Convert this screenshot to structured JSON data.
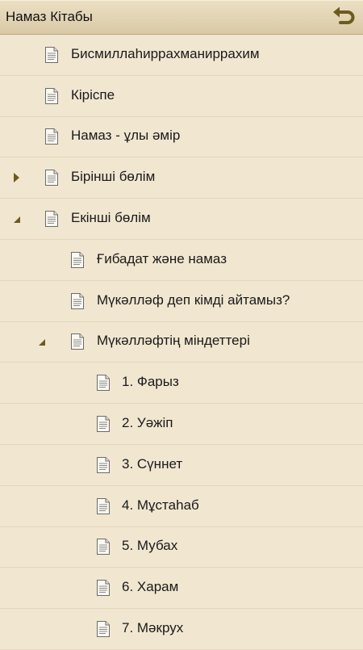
{
  "app": {
    "title": "Намаз Кітабы"
  },
  "colors": {
    "accent": "#6d5a1f",
    "background": "#f1e6d0"
  },
  "icons": {
    "back": "back-arrow-icon",
    "item": "document-icon"
  },
  "tree": [
    {
      "label": "Бисмиллаһиррахманиррахим",
      "level": 0,
      "state": "leaf"
    },
    {
      "label": "Кіріспе",
      "level": 0,
      "state": "leaf"
    },
    {
      "label": "Намаз - ұлы әмір",
      "level": 0,
      "state": "leaf"
    },
    {
      "label": "Бірінші бөлім",
      "level": 0,
      "state": "collapsed"
    },
    {
      "label": "Екінші бөлім",
      "level": 0,
      "state": "expanded"
    },
    {
      "label": "Ғибадат және намаз",
      "level": 1,
      "state": "leaf"
    },
    {
      "label": "Мүкәлләф деп кімді айтамыз?",
      "level": 1,
      "state": "leaf"
    },
    {
      "label": "Мүкәлләфтің міндеттері",
      "level": 1,
      "state": "expanded"
    },
    {
      "label": "1. Фарыз",
      "level": 2,
      "state": "leaf"
    },
    {
      "label": "2. Уәжіп",
      "level": 2,
      "state": "leaf"
    },
    {
      "label": "3. Сүннет",
      "level": 2,
      "state": "leaf"
    },
    {
      "label": "4. Мұстаһаб",
      "level": 2,
      "state": "leaf"
    },
    {
      "label": "5. Мубах",
      "level": 2,
      "state": "leaf"
    },
    {
      "label": "6. Харам",
      "level": 2,
      "state": "leaf"
    },
    {
      "label": "7. Мәкрух",
      "level": 2,
      "state": "leaf"
    }
  ]
}
